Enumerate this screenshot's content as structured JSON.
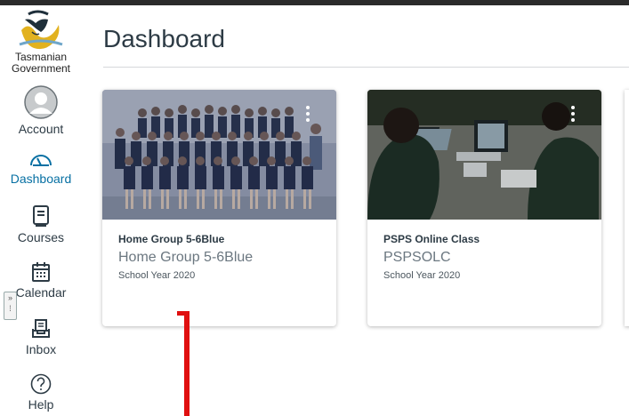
{
  "brand": {
    "line1": "Tasmanian",
    "line2": "Government"
  },
  "nav": {
    "account": "Account",
    "dashboard": "Dashboard",
    "courses": "Courses",
    "calendar": "Calendar",
    "inbox": "Inbox",
    "help": "Help"
  },
  "page": {
    "title": "Dashboard"
  },
  "cards": [
    {
      "title": "Home Group 5-6Blue",
      "subtitle": "Home Group 5-6Blue",
      "term": "School Year 2020",
      "image_icon": "class-photo-image"
    },
    {
      "title": "PSPS Online Class",
      "subtitle": "PSPSOLC",
      "term": "School Year 2020",
      "image_icon": "students-laptops-image"
    }
  ],
  "colors": {
    "accent": "#0770a3",
    "text": "#2d3b45",
    "annotation": "#e01010"
  }
}
